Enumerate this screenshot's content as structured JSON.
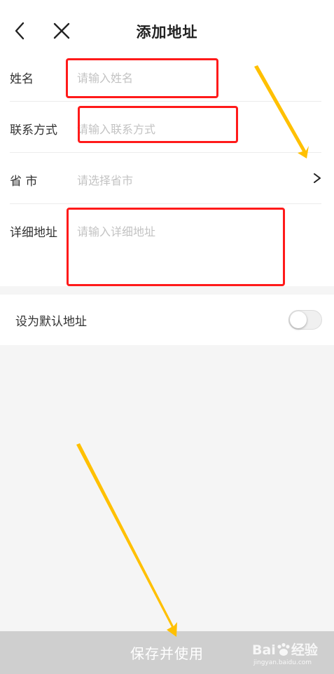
{
  "header": {
    "title": "添加地址",
    "back_icon": "chevron-left-icon",
    "close_icon": "close-icon"
  },
  "form": {
    "name": {
      "label": "姓名",
      "placeholder": "请输入姓名"
    },
    "phone": {
      "label": "联系方式",
      "placeholder": "请输入联系方式"
    },
    "region": {
      "label": "省 市",
      "placeholder": "请选择省市",
      "icon": "chevron-right-icon"
    },
    "detail": {
      "label": "详细地址",
      "placeholder": "请输入详细地址"
    }
  },
  "default_address": {
    "label": "设为默认地址",
    "enabled": false
  },
  "footer": {
    "save_label": "保存并使用"
  },
  "watermark": {
    "brand_left": "Bai",
    "brand_right": "经验",
    "url": "jingyan.baidu.com"
  },
  "annotation_colors": {
    "highlight_box": "#ff1a1a",
    "arrow": "#ffc000"
  }
}
